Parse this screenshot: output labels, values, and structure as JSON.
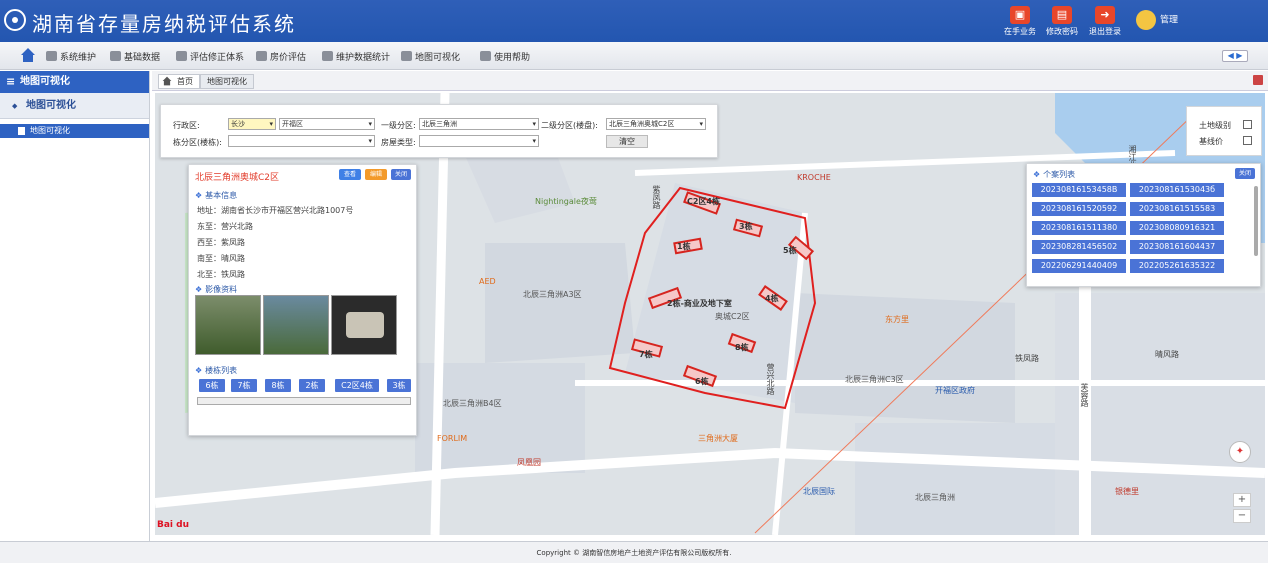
{
  "header": {
    "title": "湖南省存量房纳税评估系统",
    "buttons": [
      {
        "label": "在手业务",
        "icon": "briefcase-icon"
      },
      {
        "label": "修改密码",
        "icon": "lock-icon"
      },
      {
        "label": "退出登录",
        "icon": "exit-icon"
      }
    ],
    "user": "管理"
  },
  "menu": {
    "items": [
      "系统维护",
      "基础数据",
      "评估修正体系",
      "房价评估",
      "维护数据统计",
      "地图可视化",
      "使用帮助"
    ],
    "arrows": "◀ ▶"
  },
  "sidebar": {
    "title": "地图可视化",
    "group": "地图可视化",
    "item": "地图可视化"
  },
  "tabs": [
    "首页",
    "地图可视化"
  ],
  "filter": {
    "district_label": "行政区:",
    "city": "长沙",
    "district": "开福区",
    "level1_label": "一级分区:",
    "level1": "北辰三角洲",
    "level2_label": "二级分区(楼盘):",
    "level2": "北辰三角洲奥城C2区",
    "building_label": "栋分区(楼栋):",
    "building": "",
    "type_label": "房屋类型:",
    "type": "",
    "clear": "清空"
  },
  "layers": {
    "land": "土地级别",
    "baseline": "基线价"
  },
  "info": {
    "title": "北辰三角洲奥城C2区",
    "btn_view": "查看",
    "btn_edit": "编辑",
    "btn_close": "关闭",
    "basic_header": "基本信息",
    "address": "地址：湖南省长沙市开福区营兴北路1007号",
    "east": "东至：营兴北路",
    "west": "西至：紫凤路",
    "south": "南至：晴风路",
    "north": "北至：铁凤路",
    "image_header": "影像资料",
    "buildings_header": "楼栋列表",
    "buildings": [
      "6栋",
      "7栋",
      "8栋",
      "2栋",
      "C2区4栋",
      "3栋"
    ]
  },
  "cases": {
    "header": "个案列表",
    "close": "关闭",
    "ids": [
      "20230816153458B",
      "20230816153043б",
      "20230816152059​2",
      "202308161515​583",
      "20230816151138​0",
      "20230808091632​1",
      "20230828145650​2",
      "20230816160443​7",
      "20220629144040​9",
      "20220526163532​2"
    ]
  },
  "map_labels": [
    "北辰三角洲A3区",
    "北辰三角洲B4区",
    "北辰三角洲C3区",
    "奥城C2区",
    "2栋-商业及地下室",
    "C2区4栋",
    "3栋",
    "4栋",
    "5栋",
    "6栋",
    "7栋",
    "8栋",
    "1栋",
    "Nightingale夜莺",
    "KROCHE",
    "芙蓉路",
    "湘江北路",
    "晴风路",
    "紫凤路",
    "铁凤路",
    "营兴北路",
    "北辰三角洲",
    "开福区政府",
    "东方里",
    "北辰国际",
    "银德里",
    "三角洲大厦",
    "FORLIM",
    "凤凰园",
    "AED"
  ],
  "colors": {
    "primary": "#2e62c2",
    "accent": "#e23b2a",
    "case_btn": "#4a73d6"
  },
  "footer": "Copyright © 湖南智信房地产土地资产评估有限公司版权所有.",
  "map_logo": "Bai du"
}
